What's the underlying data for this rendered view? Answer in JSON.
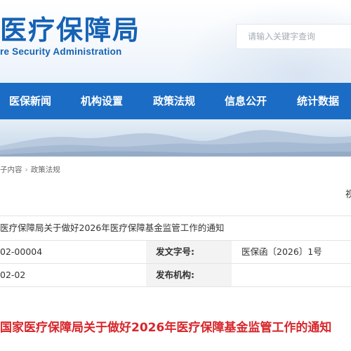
{
  "header": {
    "logo_cn": "医疗保障局",
    "logo_en": "re Security Administration",
    "search_placeholder": "请输入关键字查询"
  },
  "nav": {
    "items": [
      "医保新闻",
      "机构设置",
      "政策法规",
      "信息公开",
      "统计数据"
    ]
  },
  "breadcrumb": {
    "items": [
      "子内容",
      "政策法规"
    ],
    "separator": "›"
  },
  "view_label": "视",
  "info": {
    "title": "医疗保障局关于做好2026年医疗保障基金监管工作的通知",
    "rows": [
      {
        "left": "02-00004",
        "key": "发文字号:",
        "value": "医保函〔2026〕1号"
      },
      {
        "left": "02-02",
        "key": "发布机构:",
        "value": ""
      }
    ]
  },
  "article": {
    "title": "国家医疗保障局关于做好2026年医疗保障基金监管工作的通知"
  },
  "colors": {
    "brand_blue": "#1662b5",
    "nav_blue": "#1b6cc4",
    "title_red": "#d8262b"
  }
}
